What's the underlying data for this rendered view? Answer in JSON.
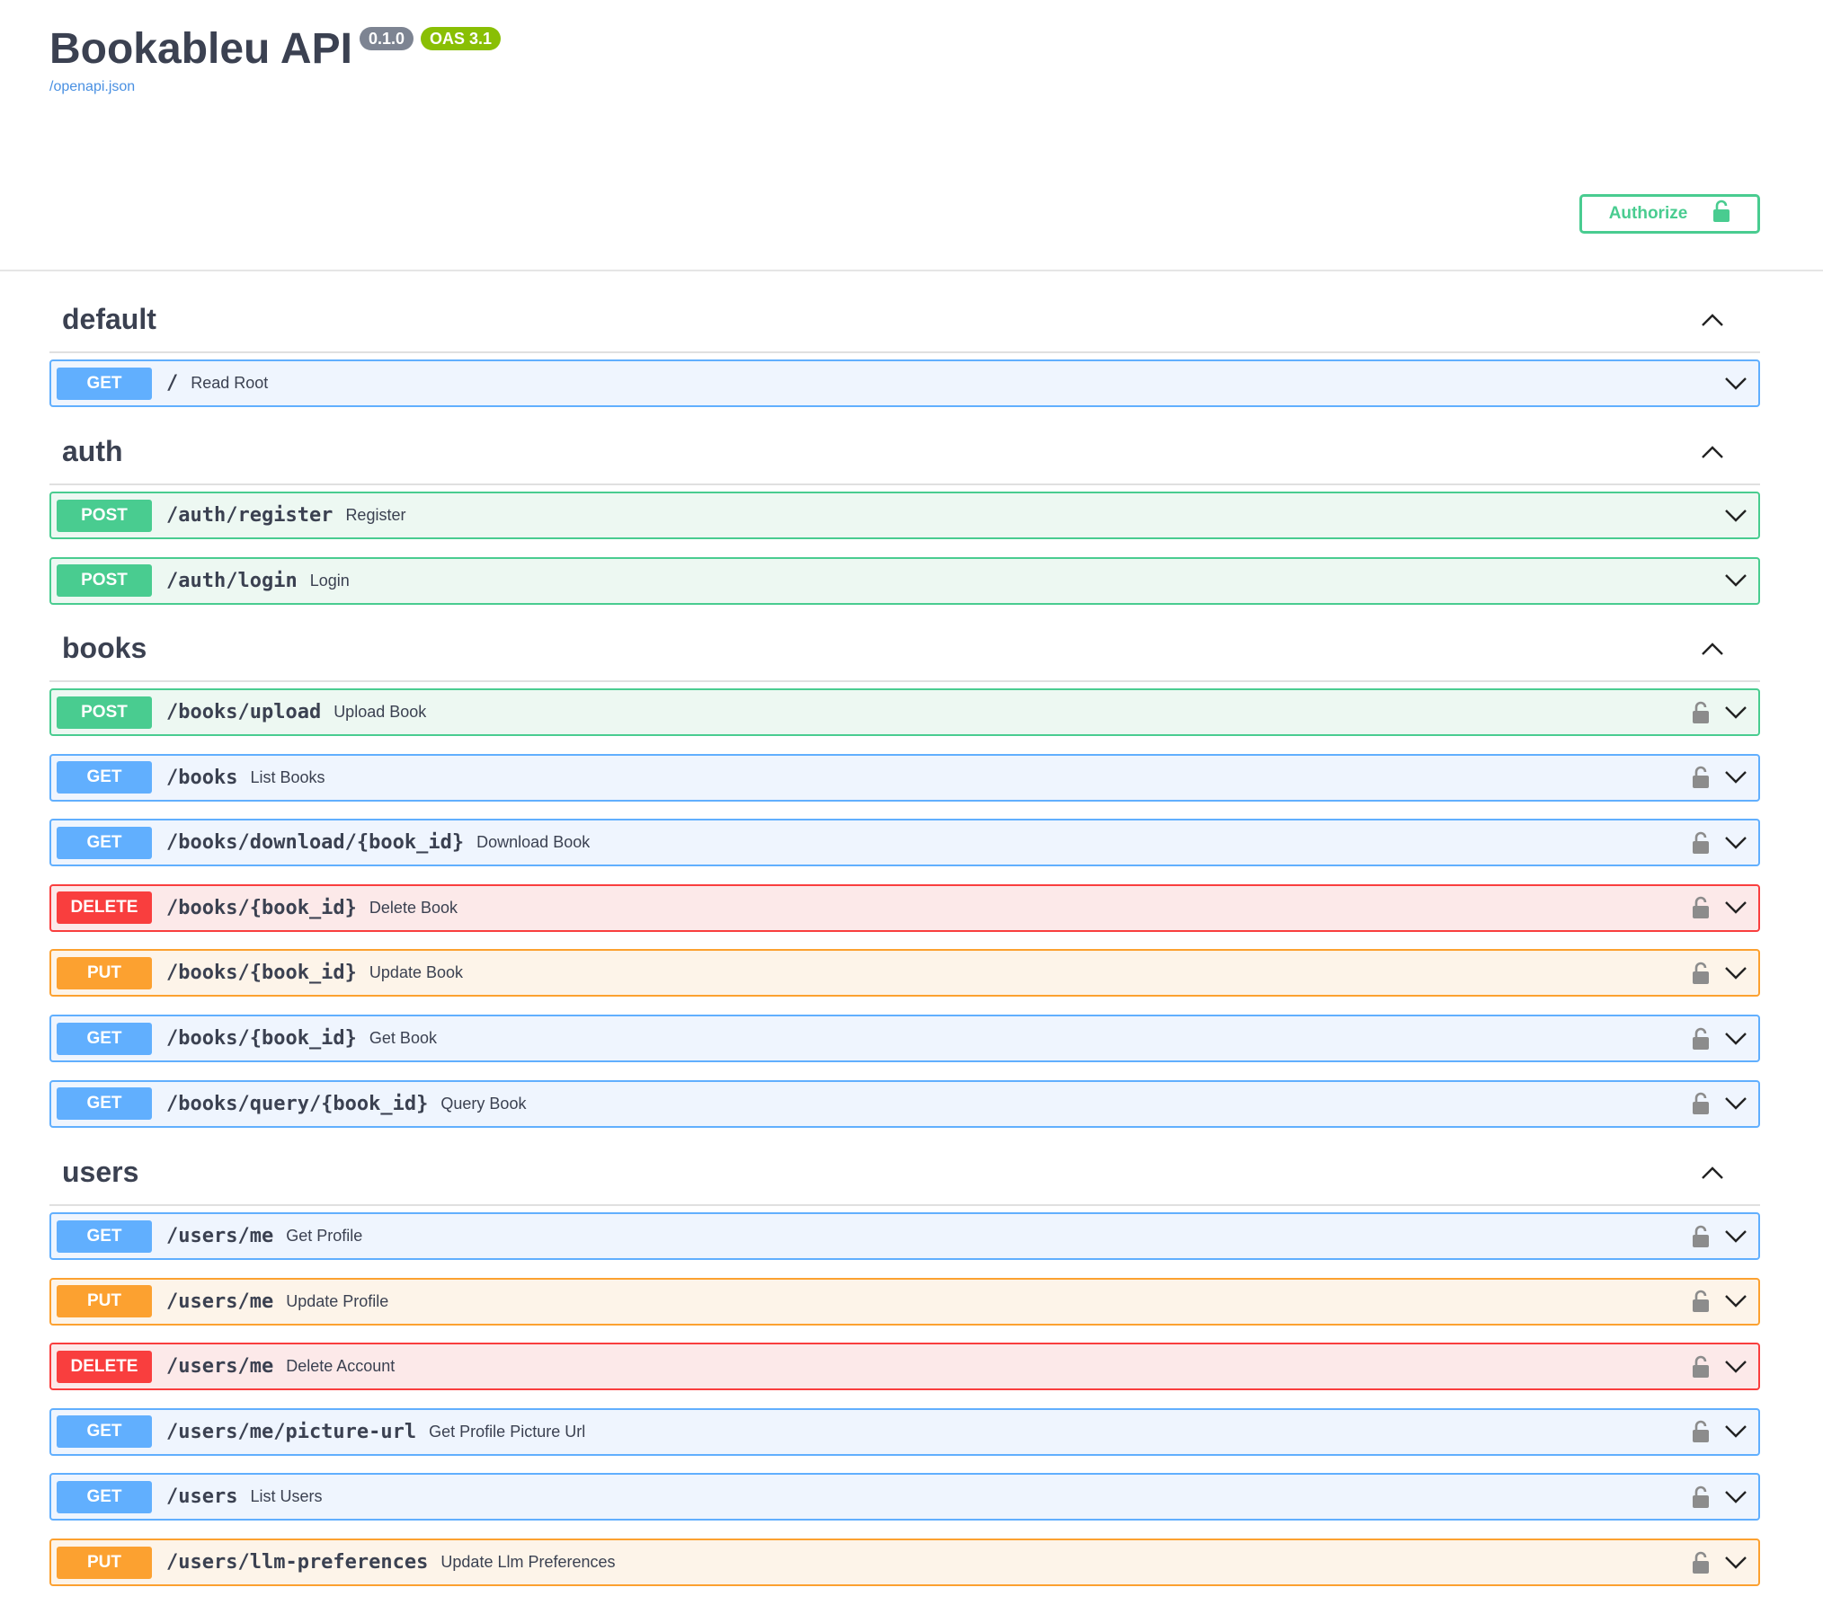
{
  "info": {
    "title": "Bookableu API",
    "version": "0.1.0",
    "oas": "OAS 3.1",
    "spec_link": "/openapi.json",
    "authorize_label": "Authorize"
  },
  "colors": {
    "get": "#61affe",
    "post": "#49cc90",
    "delete": "#f93e3e",
    "put": "#fca130",
    "authorize": "#49cc90"
  },
  "tags": [
    {
      "name": "default",
      "operations": [
        {
          "method": "GET",
          "path": "/",
          "summary": "Read Root",
          "locked": false
        }
      ]
    },
    {
      "name": "auth",
      "operations": [
        {
          "method": "POST",
          "path": "/auth/register",
          "summary": "Register",
          "locked": false
        },
        {
          "method": "POST",
          "path": "/auth/login",
          "summary": "Login",
          "locked": false
        }
      ]
    },
    {
      "name": "books",
      "operations": [
        {
          "method": "POST",
          "path": "/books/upload",
          "summary": "Upload Book",
          "locked": true
        },
        {
          "method": "GET",
          "path": "/books",
          "summary": "List Books",
          "locked": true
        },
        {
          "method": "GET",
          "path": "/books/download/{book_id}",
          "summary": "Download Book",
          "locked": true
        },
        {
          "method": "DELETE",
          "path": "/books/{book_id}",
          "summary": "Delete Book",
          "locked": true
        },
        {
          "method": "PUT",
          "path": "/books/{book_id}",
          "summary": "Update Book",
          "locked": true
        },
        {
          "method": "GET",
          "path": "/books/{book_id}",
          "summary": "Get Book",
          "locked": true
        },
        {
          "method": "GET",
          "path": "/books/query/{book_id}",
          "summary": "Query Book",
          "locked": true
        }
      ]
    },
    {
      "name": "users",
      "operations": [
        {
          "method": "GET",
          "path": "/users/me",
          "summary": "Get Profile",
          "locked": true
        },
        {
          "method": "PUT",
          "path": "/users/me",
          "summary": "Update Profile",
          "locked": true
        },
        {
          "method": "DELETE",
          "path": "/users/me",
          "summary": "Delete Account",
          "locked": true
        },
        {
          "method": "GET",
          "path": "/users/me/picture-url",
          "summary": "Get Profile Picture Url",
          "locked": true
        },
        {
          "method": "GET",
          "path": "/users",
          "summary": "List Users",
          "locked": true
        },
        {
          "method": "PUT",
          "path": "/users/llm-preferences",
          "summary": "Update Llm Preferences",
          "locked": true
        }
      ]
    }
  ]
}
